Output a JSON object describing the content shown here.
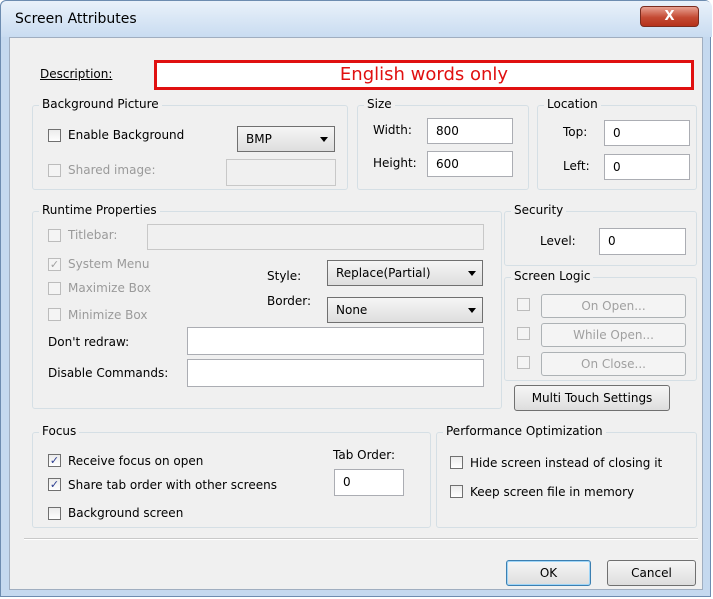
{
  "window": {
    "title": "Screen Attributes",
    "close_glyph": "X"
  },
  "description": {
    "label": "Description:",
    "value": "English words only"
  },
  "background_picture": {
    "title": "Background Picture",
    "enable_label": "Enable Background",
    "format_value": "BMP",
    "shared_label": "Shared image:"
  },
  "size": {
    "title": "Size",
    "width_label": "Width:",
    "width_value": "800",
    "height_label": "Height:",
    "height_value": "600"
  },
  "location": {
    "title": "Location",
    "top_label": "Top:",
    "top_value": "0",
    "left_label": "Left:",
    "left_value": "0"
  },
  "runtime": {
    "title": "Runtime Properties",
    "titlebar_label": "Titlebar:",
    "system_menu_label": "System Menu",
    "maximize_label": "Maximize Box",
    "minimize_label": "Minimize Box",
    "style_label": "Style:",
    "style_value": "Replace(Partial)",
    "border_label": "Border:",
    "border_value": "None",
    "dont_redraw_label": "Don't redraw:",
    "disable_commands_label": "Disable Commands:"
  },
  "security": {
    "title": "Security",
    "level_label": "Level:",
    "level_value": "0"
  },
  "screen_logic": {
    "title": "Screen Logic",
    "on_open": "On Open...",
    "while_open": "While Open...",
    "on_close": "On Close..."
  },
  "multi_touch_label": "Multi Touch Settings",
  "focus": {
    "title": "Focus",
    "receive_label": "Receive focus on open",
    "share_label": "Share tab order with other screens",
    "background_label": "Background screen",
    "tab_order_label": "Tab Order:",
    "tab_order_value": "0"
  },
  "performance": {
    "title": "Performance Optimization",
    "hide_label": "Hide screen instead of closing it",
    "keep_label": "Keep screen file in memory"
  },
  "buttons": {
    "ok": "OK",
    "cancel": "Cancel"
  },
  "checkbox_glyph": "✓"
}
